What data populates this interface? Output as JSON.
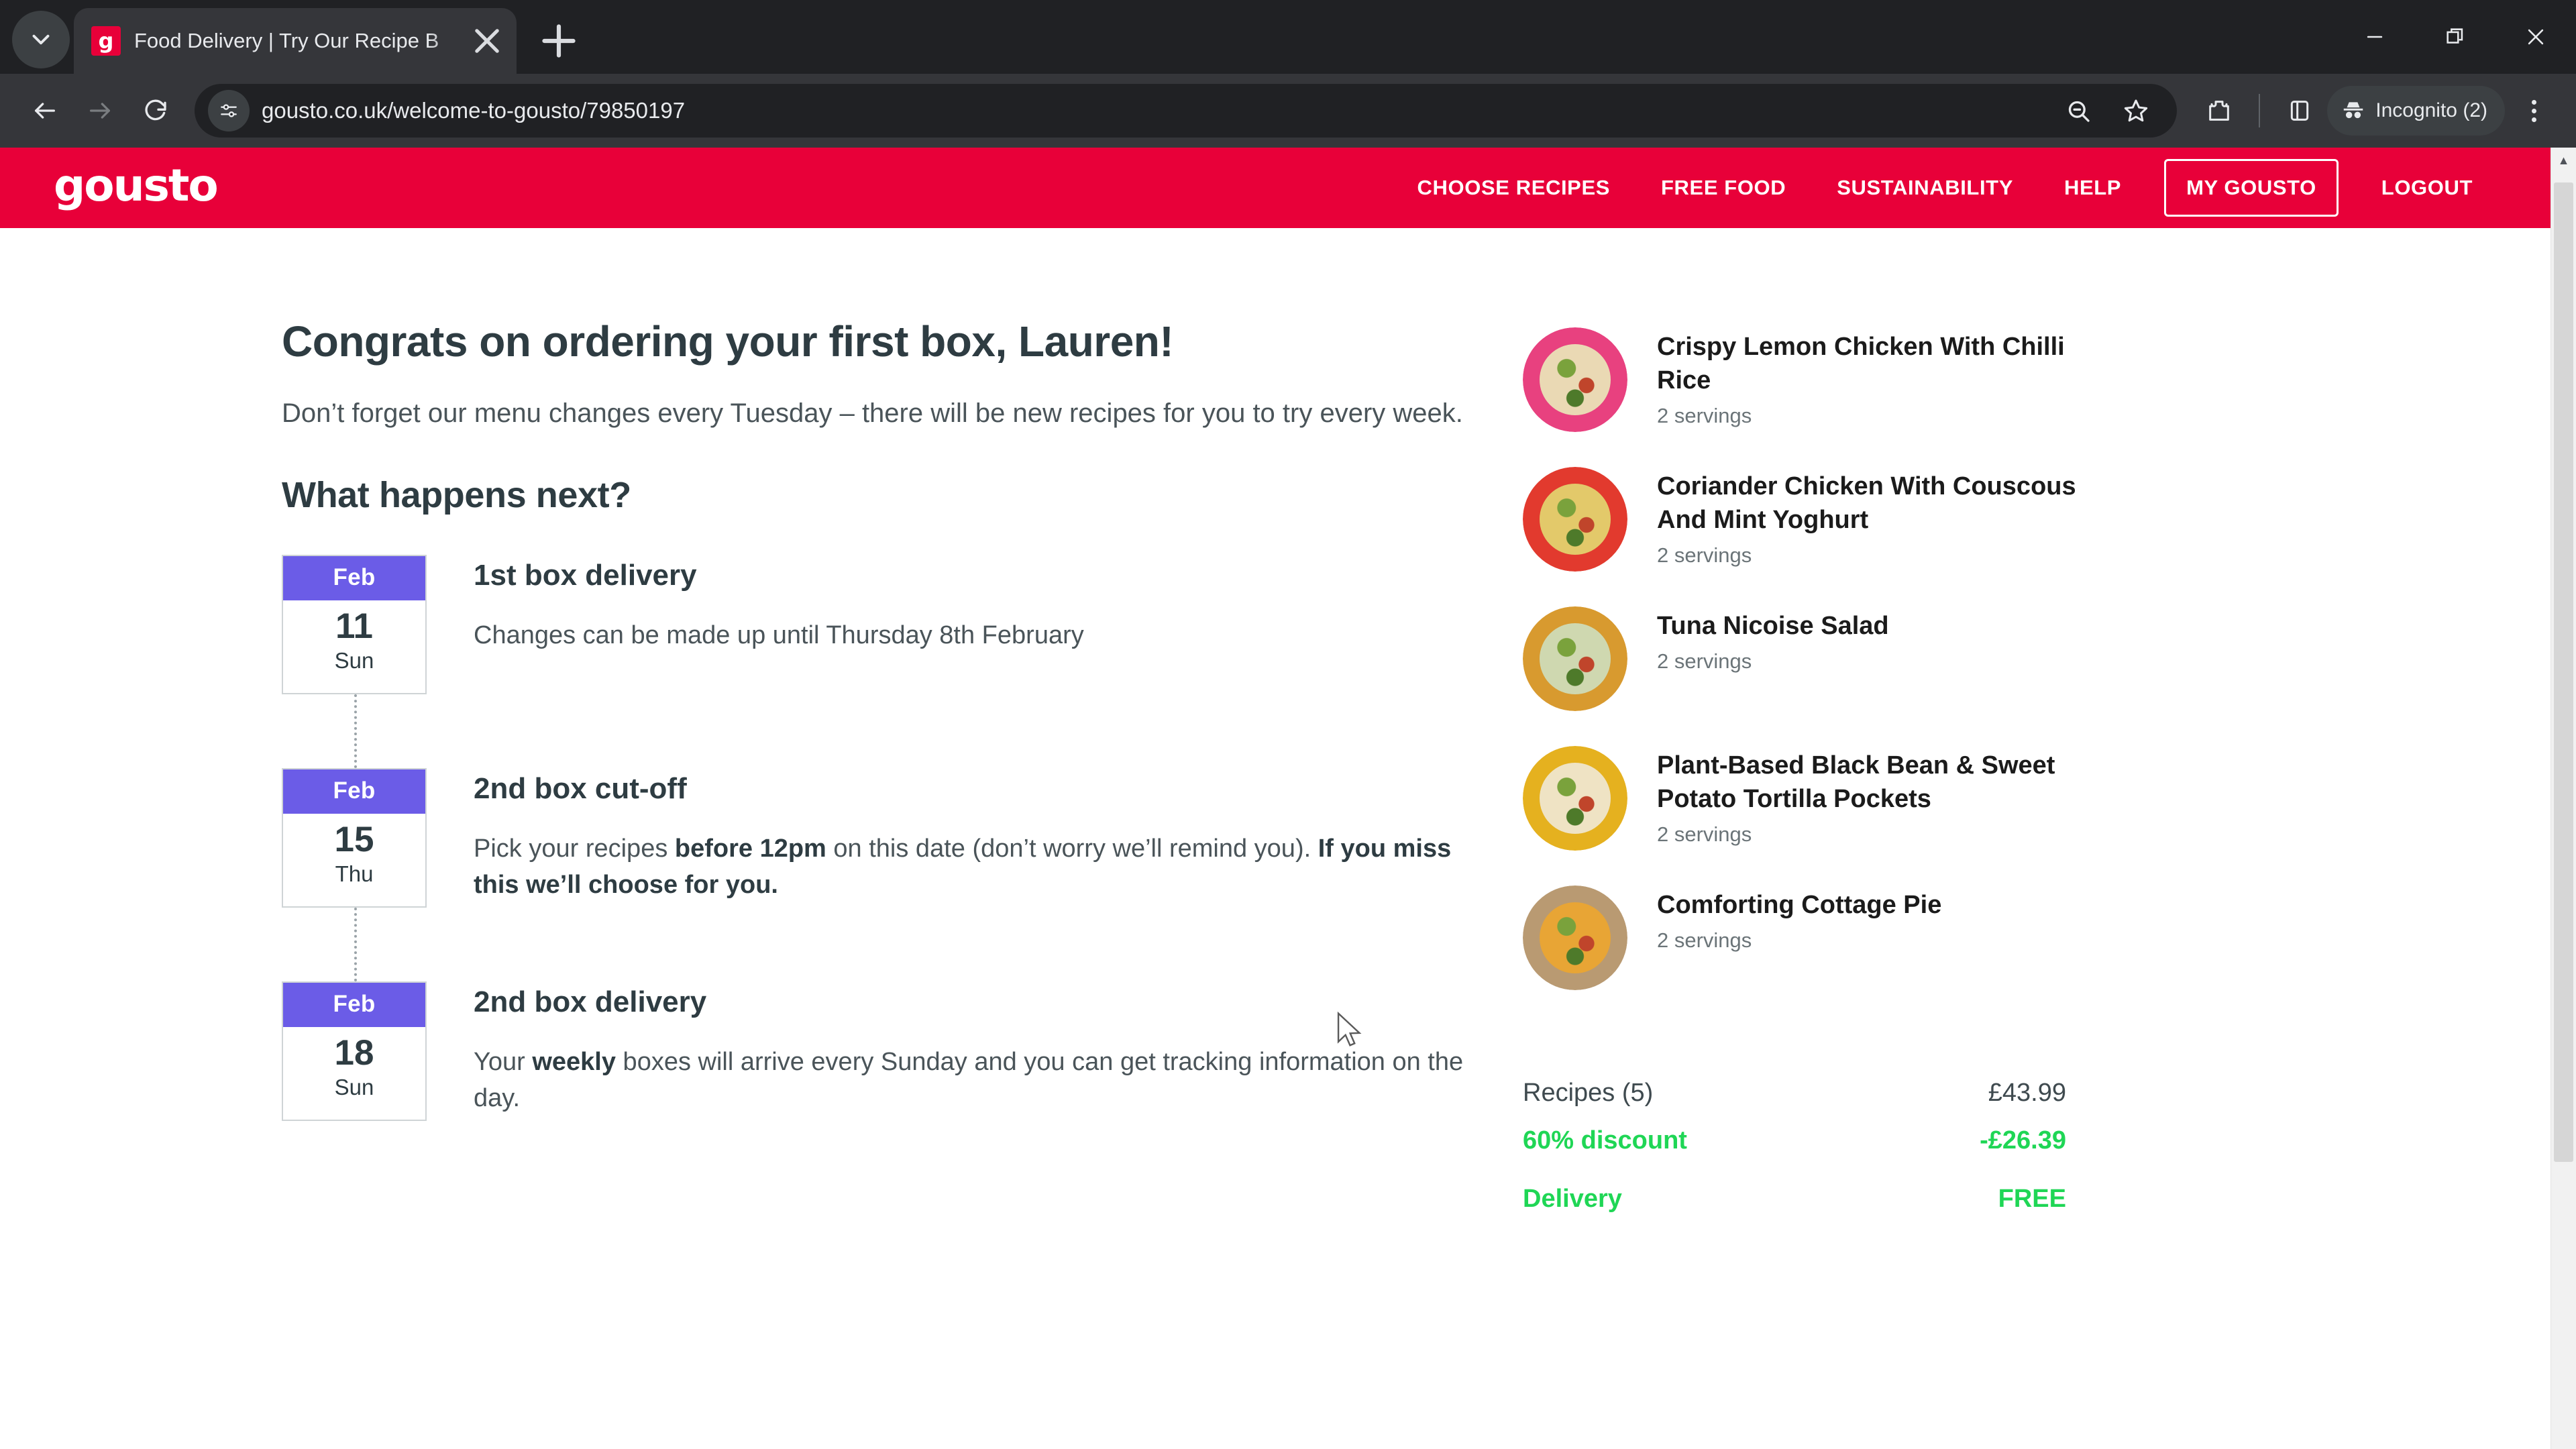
{
  "browser": {
    "tab": {
      "title": "Food Delivery | Try Our Recipe B",
      "favicon_letter": "g",
      "close_label": "✕"
    },
    "new_tab_label": "+",
    "url": "gousto.co.uk/welcome-to-gousto/79850197",
    "profile_label": "Incognito (2)",
    "icons": {
      "tab_search": "chevron-down-icon",
      "back": "back-arrow-icon",
      "forward": "forward-arrow-icon",
      "reload": "reload-icon",
      "site_info": "site-settings-icon",
      "zoom": "search-zoom-out-icon",
      "bookmark": "star-icon",
      "extensions": "extensions-puzzle-icon",
      "side_panel": "side-panel-icon",
      "incognito": "incognito-hat-icon",
      "menu": "three-dot-menu-icon",
      "minimize": "minimize-icon",
      "maximize": "restore-window-icon",
      "close": "close-window-icon"
    }
  },
  "site": {
    "brand": "gousto",
    "brand_color": "#e80039",
    "accent_purple": "#6b5ce7",
    "success_green": "#1fd655",
    "nav": [
      {
        "label": "CHOOSE RECIPES",
        "boxed": false
      },
      {
        "label": "FREE FOOD",
        "boxed": false
      },
      {
        "label": "SUSTAINABILITY",
        "boxed": false
      },
      {
        "label": "HELP",
        "boxed": false
      },
      {
        "label": "MY GOUSTO",
        "boxed": true
      },
      {
        "label": "LOGOUT",
        "boxed": false
      }
    ]
  },
  "main": {
    "heading": "Congrats on ordering your first box, Lauren!",
    "intro": "Don’t forget our menu changes every Tuesday – there will be new recipes for you to try every week.",
    "subheading": "What happens next?",
    "timeline": [
      {
        "month": "Feb",
        "day": "11",
        "weekday": "Sun",
        "title": "1st box delivery",
        "desc_parts": [
          {
            "text": "Changes can be made up until Thursday 8th February",
            "bold": false
          }
        ]
      },
      {
        "month": "Feb",
        "day": "15",
        "weekday": "Thu",
        "title": "2nd box cut-off",
        "desc_parts": [
          {
            "text": "Pick your recipes ",
            "bold": false
          },
          {
            "text": "before 12pm",
            "bold": true
          },
          {
            "text": " on this date (don’t worry we’ll remind you). ",
            "bold": false
          },
          {
            "text": "If you miss this we’ll choose for you.",
            "bold": true
          }
        ]
      },
      {
        "month": "Feb",
        "day": "18",
        "weekday": "Sun",
        "title": "2nd box delivery",
        "desc_parts": [
          {
            "text": "Your ",
            "bold": false
          },
          {
            "text": "weekly",
            "bold": true
          },
          {
            "text": " boxes will arrive every Sunday and you can get tracking information on the day.",
            "bold": false
          }
        ]
      }
    ]
  },
  "sidebar": {
    "recipes": [
      {
        "name": "Crispy Lemon Chicken With Chilli Rice",
        "servings": "2 servings",
        "plate_color": "#e8417f",
        "food_color": "#ead9b4"
      },
      {
        "name": "Coriander Chicken With Couscous And Mint Yoghurt",
        "servings": "2 servings",
        "plate_color": "#e23a2e",
        "food_color": "#e3c96a"
      },
      {
        "name": "Tuna Nicoise Salad",
        "servings": "2 servings",
        "plate_color": "#d89a2f",
        "food_color": "#cfd8b0"
      },
      {
        "name": "Plant-Based Black Bean & Sweet Potato Tortilla Pockets",
        "servings": "2 servings",
        "plate_color": "#e5b11f",
        "food_color": "#efe3c4"
      },
      {
        "name": "Comforting Cottage Pie",
        "servings": "2 servings",
        "plate_color": "#b99a72",
        "food_color": "#e8a535"
      }
    ],
    "summary": [
      {
        "label": "Recipes (5)",
        "value": "£43.99",
        "green": false
      },
      {
        "label": "60% discount",
        "value": "-£26.39",
        "green": true
      },
      {
        "label": "Delivery",
        "value": "FREE",
        "green": true,
        "gap": true
      }
    ]
  }
}
